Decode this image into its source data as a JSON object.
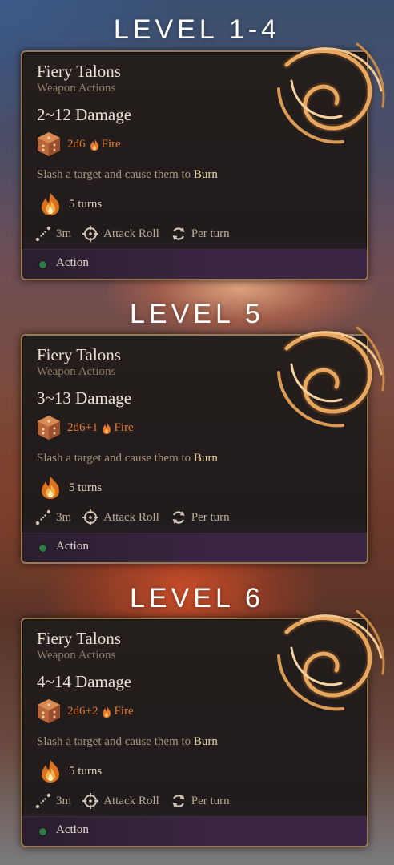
{
  "cards": [
    {
      "level_heading": "LEVEL 1-4",
      "title": "Fiery Talons",
      "subtitle": "Weapon Actions",
      "damage": "2~12 Damage",
      "dice": "2d6",
      "damage_type": "Fire",
      "description": "Slash a target and cause them to ",
      "description_keyword": "Burn",
      "status_duration": "5 turns",
      "range": "3m",
      "roll_type": "Attack Roll",
      "recharge": "Per turn",
      "cost": "Action"
    },
    {
      "level_heading": "LEVEL 5",
      "title": "Fiery Talons",
      "subtitle": "Weapon Actions",
      "damage": "3~13 Damage",
      "dice": "2d6+1",
      "damage_type": "Fire",
      "description": "Slash a target and cause them to ",
      "description_keyword": "Burn",
      "status_duration": "5 turns",
      "range": "3m",
      "roll_type": "Attack Roll",
      "recharge": "Per turn",
      "cost": "Action"
    },
    {
      "level_heading": "LEVEL 6",
      "title": "Fiery Talons",
      "subtitle": "Weapon Actions",
      "damage": "4~14 Damage",
      "dice": "2d6+2",
      "damage_type": "Fire",
      "description": "Slash a target and cause them to ",
      "description_keyword": "Burn",
      "status_duration": "5 turns",
      "range": "3m",
      "roll_type": "Attack Roll",
      "recharge": "Per turn",
      "cost": "Action"
    }
  ],
  "icons": {
    "spell": "fiery-talons-claw-icon",
    "dice": "d6-dice-icon",
    "damage_type": "fire-icon",
    "status": "burning-status-icon",
    "range": "range-icon",
    "roll": "crosshair-icon",
    "recharge": "recharge-icon",
    "cost": "action-dot-icon"
  },
  "colors": {
    "damage_type": "#e07a32",
    "keyword": "#e8d7a0",
    "action_resource": "#2e7a45",
    "card_border": "#9a7a55"
  }
}
